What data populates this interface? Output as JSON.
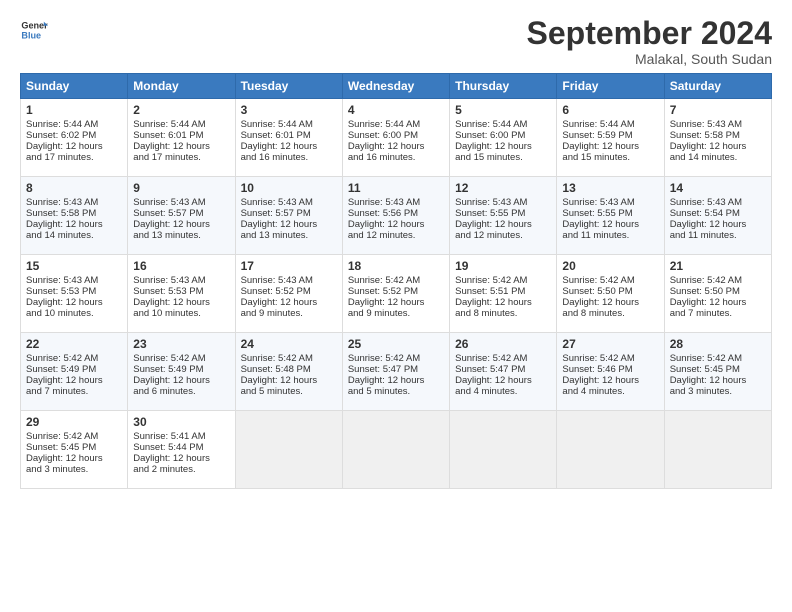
{
  "header": {
    "logo_line1": "General",
    "logo_line2": "Blue",
    "month_year": "September 2024",
    "location": "Malakal, South Sudan"
  },
  "days_of_week": [
    "Sunday",
    "Monday",
    "Tuesday",
    "Wednesday",
    "Thursday",
    "Friday",
    "Saturday"
  ],
  "weeks": [
    [
      {
        "day": "1",
        "lines": [
          "Sunrise: 5:44 AM",
          "Sunset: 6:02 PM",
          "Daylight: 12 hours",
          "and 17 minutes."
        ]
      },
      {
        "day": "2",
        "lines": [
          "Sunrise: 5:44 AM",
          "Sunset: 6:01 PM",
          "Daylight: 12 hours",
          "and 17 minutes."
        ]
      },
      {
        "day": "3",
        "lines": [
          "Sunrise: 5:44 AM",
          "Sunset: 6:01 PM",
          "Daylight: 12 hours",
          "and 16 minutes."
        ]
      },
      {
        "day": "4",
        "lines": [
          "Sunrise: 5:44 AM",
          "Sunset: 6:00 PM",
          "Daylight: 12 hours",
          "and 16 minutes."
        ]
      },
      {
        "day": "5",
        "lines": [
          "Sunrise: 5:44 AM",
          "Sunset: 6:00 PM",
          "Daylight: 12 hours",
          "and 15 minutes."
        ]
      },
      {
        "day": "6",
        "lines": [
          "Sunrise: 5:44 AM",
          "Sunset: 5:59 PM",
          "Daylight: 12 hours",
          "and 15 minutes."
        ]
      },
      {
        "day": "7",
        "lines": [
          "Sunrise: 5:43 AM",
          "Sunset: 5:58 PM",
          "Daylight: 12 hours",
          "and 14 minutes."
        ]
      }
    ],
    [
      {
        "day": "8",
        "lines": [
          "Sunrise: 5:43 AM",
          "Sunset: 5:58 PM",
          "Daylight: 12 hours",
          "and 14 minutes."
        ]
      },
      {
        "day": "9",
        "lines": [
          "Sunrise: 5:43 AM",
          "Sunset: 5:57 PM",
          "Daylight: 12 hours",
          "and 13 minutes."
        ]
      },
      {
        "day": "10",
        "lines": [
          "Sunrise: 5:43 AM",
          "Sunset: 5:57 PM",
          "Daylight: 12 hours",
          "and 13 minutes."
        ]
      },
      {
        "day": "11",
        "lines": [
          "Sunrise: 5:43 AM",
          "Sunset: 5:56 PM",
          "Daylight: 12 hours",
          "and 12 minutes."
        ]
      },
      {
        "day": "12",
        "lines": [
          "Sunrise: 5:43 AM",
          "Sunset: 5:55 PM",
          "Daylight: 12 hours",
          "and 12 minutes."
        ]
      },
      {
        "day": "13",
        "lines": [
          "Sunrise: 5:43 AM",
          "Sunset: 5:55 PM",
          "Daylight: 12 hours",
          "and 11 minutes."
        ]
      },
      {
        "day": "14",
        "lines": [
          "Sunrise: 5:43 AM",
          "Sunset: 5:54 PM",
          "Daylight: 12 hours",
          "and 11 minutes."
        ]
      }
    ],
    [
      {
        "day": "15",
        "lines": [
          "Sunrise: 5:43 AM",
          "Sunset: 5:53 PM",
          "Daylight: 12 hours",
          "and 10 minutes."
        ]
      },
      {
        "day": "16",
        "lines": [
          "Sunrise: 5:43 AM",
          "Sunset: 5:53 PM",
          "Daylight: 12 hours",
          "and 10 minutes."
        ]
      },
      {
        "day": "17",
        "lines": [
          "Sunrise: 5:43 AM",
          "Sunset: 5:52 PM",
          "Daylight: 12 hours",
          "and 9 minutes."
        ]
      },
      {
        "day": "18",
        "lines": [
          "Sunrise: 5:42 AM",
          "Sunset: 5:52 PM",
          "Daylight: 12 hours",
          "and 9 minutes."
        ]
      },
      {
        "day": "19",
        "lines": [
          "Sunrise: 5:42 AM",
          "Sunset: 5:51 PM",
          "Daylight: 12 hours",
          "and 8 minutes."
        ]
      },
      {
        "day": "20",
        "lines": [
          "Sunrise: 5:42 AM",
          "Sunset: 5:50 PM",
          "Daylight: 12 hours",
          "and 8 minutes."
        ]
      },
      {
        "day": "21",
        "lines": [
          "Sunrise: 5:42 AM",
          "Sunset: 5:50 PM",
          "Daylight: 12 hours",
          "and 7 minutes."
        ]
      }
    ],
    [
      {
        "day": "22",
        "lines": [
          "Sunrise: 5:42 AM",
          "Sunset: 5:49 PM",
          "Daylight: 12 hours",
          "and 7 minutes."
        ]
      },
      {
        "day": "23",
        "lines": [
          "Sunrise: 5:42 AM",
          "Sunset: 5:49 PM",
          "Daylight: 12 hours",
          "and 6 minutes."
        ]
      },
      {
        "day": "24",
        "lines": [
          "Sunrise: 5:42 AM",
          "Sunset: 5:48 PM",
          "Daylight: 12 hours",
          "and 5 minutes."
        ]
      },
      {
        "day": "25",
        "lines": [
          "Sunrise: 5:42 AM",
          "Sunset: 5:47 PM",
          "Daylight: 12 hours",
          "and 5 minutes."
        ]
      },
      {
        "day": "26",
        "lines": [
          "Sunrise: 5:42 AM",
          "Sunset: 5:47 PM",
          "Daylight: 12 hours",
          "and 4 minutes."
        ]
      },
      {
        "day": "27",
        "lines": [
          "Sunrise: 5:42 AM",
          "Sunset: 5:46 PM",
          "Daylight: 12 hours",
          "and 4 minutes."
        ]
      },
      {
        "day": "28",
        "lines": [
          "Sunrise: 5:42 AM",
          "Sunset: 5:45 PM",
          "Daylight: 12 hours",
          "and 3 minutes."
        ]
      }
    ],
    [
      {
        "day": "29",
        "lines": [
          "Sunrise: 5:42 AM",
          "Sunset: 5:45 PM",
          "Daylight: 12 hours",
          "and 3 minutes."
        ]
      },
      {
        "day": "30",
        "lines": [
          "Sunrise: 5:41 AM",
          "Sunset: 5:44 PM",
          "Daylight: 12 hours",
          "and 2 minutes."
        ]
      },
      {
        "day": "",
        "lines": []
      },
      {
        "day": "",
        "lines": []
      },
      {
        "day": "",
        "lines": []
      },
      {
        "day": "",
        "lines": []
      },
      {
        "day": "",
        "lines": []
      }
    ]
  ]
}
